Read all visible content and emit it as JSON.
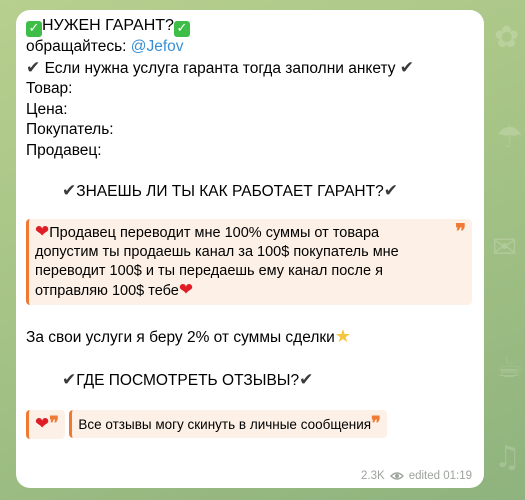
{
  "message": {
    "header_title": "НУЖЕН ГАРАНТ?",
    "contact_prefix": "обращайтесь: ",
    "contact_mention": "@Jefov",
    "intro": "Если нужна услуга гаранта тогда заполни анкету",
    "form_fields": [
      "Товар:",
      "Цена:",
      "Покупатель:",
      "Продавец:"
    ],
    "how_title": "ЗНАЕШЬ ЛИ ТЫ КАК РАБОТАЕТ ГАРАНТ?",
    "how_quote": "Продавец переводит мне 100% суммы от товара допустим ты продаешь канал за 100$ покупатель мне переводит 100$ и ты передаешь ему канал после я отправляю 100$ тебе",
    "fee_text": "За свои услуги я беру 2% от суммы сделки",
    "reviews_title": "ГДЕ ПОСМОТРЕТЬ ОТЗЫВЫ?",
    "reviews_text": "Все отзывы могу скинуть в личные сообщения",
    "views": "2.3K",
    "edited": "edited 01:19"
  },
  "colors": {
    "mention": "#3a8fd4",
    "quote_accent": "#f07a34",
    "quote_bg": "#fdf1e7",
    "check_green": "#3ebd47",
    "heart": "#e01c24"
  },
  "icons": {
    "green_check": "check-mark-button-emoji",
    "dark_check": "heavy-check-mark",
    "heart": "red-heart-emoji",
    "star": "star-emoji",
    "views": "eye-icon"
  }
}
